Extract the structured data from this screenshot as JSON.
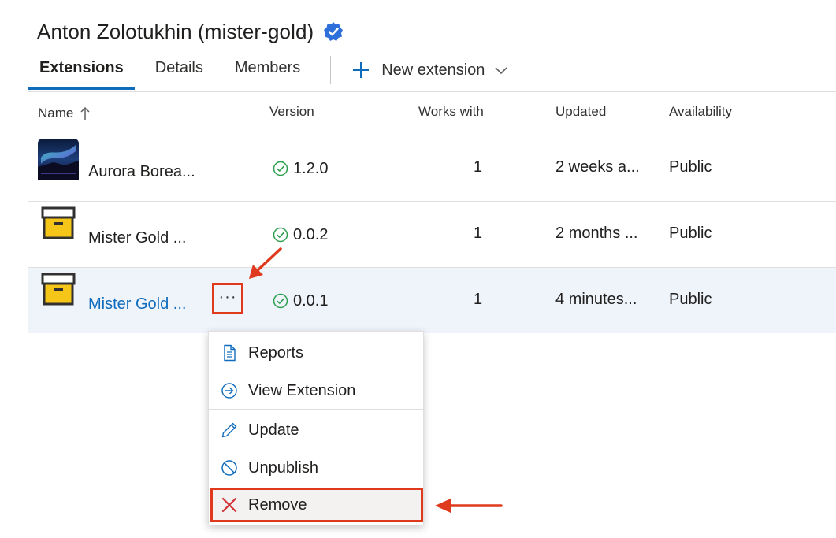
{
  "header": {
    "title": "Anton Zolotukhin (mister-gold)",
    "verified_icon": "verified-badge-icon",
    "accent": "#0f6cbd"
  },
  "tabs": [
    {
      "label": "Extensions",
      "active": true
    },
    {
      "label": "Details",
      "active": false
    },
    {
      "label": "Members",
      "active": false
    }
  ],
  "new_extension": {
    "label": "New extension",
    "icon": "plus-icon",
    "dropdown_icon": "chevron-down-icon"
  },
  "table": {
    "columns": [
      "Name",
      "Version",
      "Works with",
      "Updated",
      "Availability"
    ],
    "sort_icon": "arrow-up-icon",
    "rows": [
      {
        "name": "Aurora Borea...",
        "version": "1.2.0",
        "works_with": "1",
        "updated": "2 weeks a...",
        "availability": "Public",
        "icon": "aurora-thumbnail",
        "selected": false
      },
      {
        "name": "Mister Gold ...",
        "version": "0.0.2",
        "works_with": "1",
        "updated": "2 months ...",
        "availability": "Public",
        "icon": "package-box-icon",
        "selected": false
      },
      {
        "name": "Mister Gold ...",
        "version": "0.0.1",
        "works_with": "1",
        "updated": "4 minutes...",
        "availability": "Public",
        "icon": "package-box-icon",
        "selected": true
      }
    ],
    "more_button": "···"
  },
  "context_menu": {
    "items": [
      {
        "label": "Reports",
        "icon": "document-icon"
      },
      {
        "label": "View Extension",
        "icon": "arrow-circle-icon"
      },
      {
        "label": "Update",
        "icon": "pencil-icon"
      },
      {
        "label": "Unpublish",
        "icon": "prohibited-icon"
      },
      {
        "label": "Remove",
        "icon": "close-x-icon"
      }
    ]
  },
  "colors": {
    "highlight": "#e03a1e",
    "selected_row": "#eff4fb",
    "success": "#2e9e4f"
  }
}
